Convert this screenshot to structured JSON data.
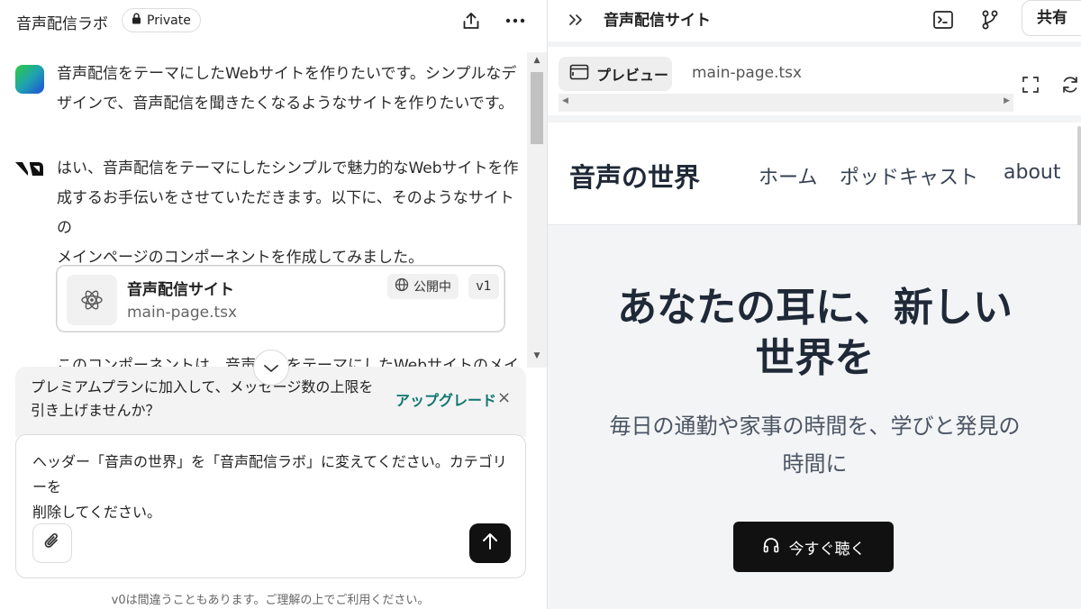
{
  "left_header": {
    "project_title": "音声配信ラボ",
    "private_label": "Private"
  },
  "chat": {
    "user_message": {
      "line1": "音声配信をテーマにしたWebサイトを作りたいです。シンプルなデ",
      "line2": "ザインで、音声配信を聞きたくなるようなサイトを作りたいです。"
    },
    "assistant_message": {
      "line1": "はい、音声配信をテーマにしたシンプルで魅力的なWebサイトを作",
      "line2": "成するお手伝いをさせていただきます。以下に、そのようなサイトの",
      "line3": "メインページのコンポーネントを作成してみました。",
      "partial": "このコンポーネントは、音声配信をテーマにしたWebサイトのメイン"
    },
    "file_card": {
      "title": "音声配信サイト",
      "filename": "main-page.tsx",
      "status": "公開中",
      "version": "v1"
    }
  },
  "upgrade": {
    "line1": "プレミアムプランに加入して、メッセージ数の上限を",
    "line2": "引き上げませんか？",
    "link": "アップグレード",
    "close": "×"
  },
  "input": {
    "line1": "ヘッダー「音声の世界」を「音声配信ラボ」に変えてください。カテゴリーを",
    "line2": "削除してください。"
  },
  "disclaimer": "v0は間違うこともあります。ご理解の上でご利用ください。",
  "right_header": {
    "title": "音声配信サイト",
    "share": "共有"
  },
  "tabs": {
    "preview": "プレビュー",
    "code": "main-page.tsx"
  },
  "site": {
    "logo": "音声の世界",
    "nav": [
      "ホーム",
      "ポッドキャスト",
      "about"
    ],
    "hero_line1": "あなたの耳に、新しい",
    "hero_line2": "世界を",
    "sub_line1": "毎日の通勤や家事の時間を、学びと発見の",
    "sub_line2": "時間に",
    "cta": "今すぐ聴く"
  },
  "colors": {
    "accent_teal": "#0f766e",
    "dark_button": "#111111",
    "preview_bg": "#f3f4f6"
  },
  "icons": [
    "lock-icon",
    "share-upload-icon",
    "more-icon",
    "double-chevron-icon",
    "terminal-icon",
    "git-branch-icon",
    "browser-icon",
    "fullscreen-icon",
    "refresh-icon",
    "react-atom-icon",
    "globe-icon",
    "chevron-down-icon",
    "paperclip-icon",
    "arrow-up-icon",
    "headphones-icon"
  ]
}
